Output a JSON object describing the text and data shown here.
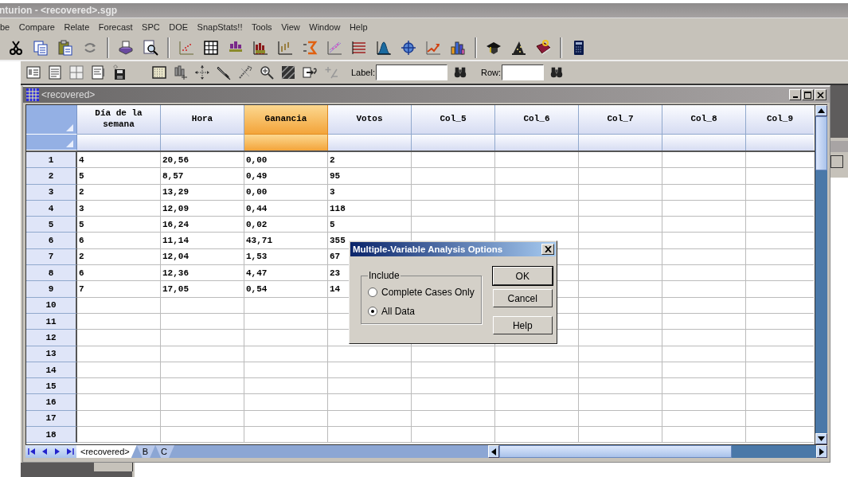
{
  "window": {
    "title": "nturion - <recovered>.sgp"
  },
  "menu": [
    "be",
    "Compare",
    "Relate",
    "Forecast",
    "SPC",
    "DOE",
    "SnapStats!!",
    "Tools",
    "View",
    "Window",
    "Help"
  ],
  "toolbar": {
    "label_field": {
      "label": "Label:"
    },
    "row_field": {
      "label": "Row:"
    }
  },
  "document": {
    "title": "<recovered>"
  },
  "table": {
    "columns": [
      {
        "name": "Día de la semana",
        "selected": false
      },
      {
        "name": "Hora",
        "selected": false
      },
      {
        "name": "Ganancia",
        "selected": true
      },
      {
        "name": "Votos",
        "selected": false
      },
      {
        "name": "Col_5",
        "selected": false
      },
      {
        "name": "Col_6",
        "selected": false
      },
      {
        "name": "Col_7",
        "selected": false
      },
      {
        "name": "Col_8",
        "selected": false
      },
      {
        "name": "Col_9",
        "selected": false
      }
    ],
    "rows": [
      {
        "number": "1",
        "cells": [
          "4",
          "20,56",
          "0,00",
          "2"
        ]
      },
      {
        "number": "2",
        "cells": [
          "5",
          "8,57",
          "0,49",
          "95"
        ]
      },
      {
        "number": "3",
        "cells": [
          "2",
          "13,29",
          "0,00",
          "3"
        ]
      },
      {
        "number": "4",
        "cells": [
          "3",
          "12,09",
          "0,44",
          "118"
        ]
      },
      {
        "number": "5",
        "cells": [
          "5",
          "16,24",
          "0,02",
          "5"
        ]
      },
      {
        "number": "6",
        "cells": [
          "6",
          "11,14",
          "43,71",
          "355"
        ]
      },
      {
        "number": "7",
        "cells": [
          "2",
          "12,04",
          "1,53",
          "67"
        ]
      },
      {
        "number": "8",
        "cells": [
          "6",
          "12,36",
          "4,47",
          "23"
        ]
      },
      {
        "number": "9",
        "cells": [
          "7",
          "17,05",
          "0,54",
          "14"
        ]
      },
      {
        "number": "10"
      },
      {
        "number": "11"
      },
      {
        "number": "12"
      },
      {
        "number": "13"
      },
      {
        "number": "14"
      },
      {
        "number": "15"
      },
      {
        "number": "16"
      },
      {
        "number": "17"
      },
      {
        "number": "18"
      }
    ]
  },
  "sheet_tabs": [
    {
      "label": "<recovered>",
      "selected": true
    },
    {
      "label": "B",
      "selected": false
    },
    {
      "label": "C",
      "selected": false
    }
  ],
  "dialog": {
    "title": "Multiple-Variable Analysis Options",
    "group": "Include",
    "options": [
      {
        "label": "Complete Cases Only",
        "selected": false
      },
      {
        "label": "All Data",
        "selected": true
      }
    ],
    "buttons": [
      {
        "label": "OK",
        "default": true
      },
      {
        "label": "Cancel",
        "default": false
      },
      {
        "label": "Help",
        "default": false
      }
    ]
  }
}
